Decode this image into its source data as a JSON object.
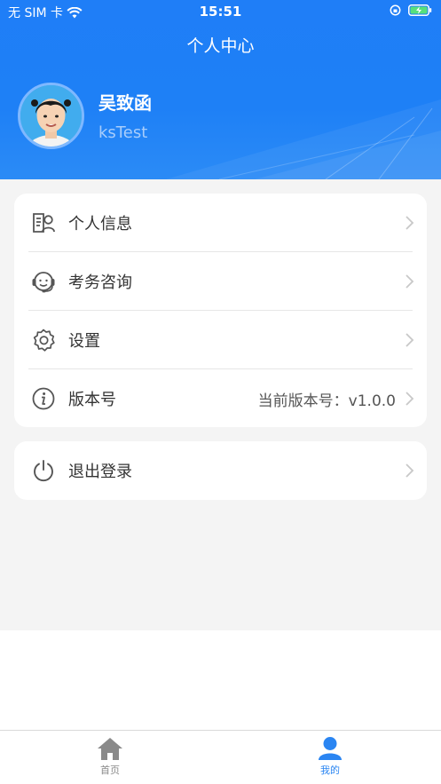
{
  "status_bar": {
    "carrier": "无 SIM 卡",
    "time": "15:51"
  },
  "header": {
    "title": "个人中心",
    "user_name": "吴致函",
    "account": "ksTest"
  },
  "menu": {
    "items": [
      {
        "label": "个人信息",
        "icon": "profile-card-icon",
        "value": ""
      },
      {
        "label": "考务咨询",
        "icon": "headset-icon",
        "value": ""
      },
      {
        "label": "设置",
        "icon": "gear-icon",
        "value": ""
      },
      {
        "label": "版本号",
        "icon": "info-icon",
        "value": "当前版本号：v1.0.0"
      }
    ]
  },
  "logout": {
    "label": "退出登录",
    "icon": "power-icon"
  },
  "tabbar": {
    "tabs": [
      {
        "label": "首页",
        "icon": "home-icon",
        "active": false
      },
      {
        "label": "我的",
        "icon": "user-icon",
        "active": true
      }
    ]
  },
  "colors": {
    "header_blue": "#1f7ef7",
    "active_tab": "#2a85f2",
    "inactive_tab": "#8a8a8a",
    "page_bg": "#f4f4f4"
  }
}
